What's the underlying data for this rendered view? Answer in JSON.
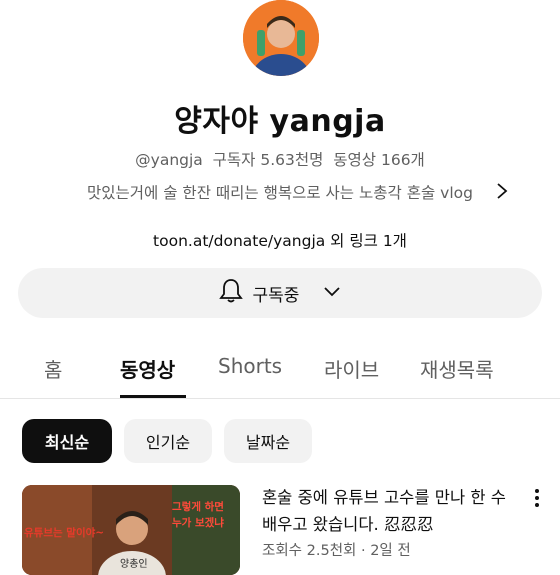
{
  "channel": {
    "name": "양자야 yangja",
    "meta": "@yangja  구독자 5.63천명  동영상 166개",
    "description": "맛있는거에 술 한잔 때리는 행복으로 사는 노총각 혼술 vlog",
    "link": "toon.at/donate/yangja 외 링크 1개"
  },
  "subscribe": {
    "label": "구독중"
  },
  "tabs": [
    "홈",
    "동영상",
    "Shorts",
    "라이브",
    "재생목록"
  ],
  "chips": [
    "최신순",
    "인기순",
    "날짜순"
  ],
  "video": {
    "title": "혼술 중에 유튜브 고수를 만나 한 수 배우고 왔습니다. 忍忍忍",
    "meta": "조회수 2.5천회 · 2일 전",
    "thumb_text_left": "유튜브는 말이야~",
    "thumb_text_right_1": "그렇게 하면",
    "thumb_text_right_2": "누가 보겠냐",
    "thumb_name": "양총인"
  },
  "colors": {
    "accent": "#0f0f0f",
    "secondary_text": "#606060",
    "chip_bg": "#f2f2f2",
    "avatar_bg": "#f07a2a"
  },
  "icons": {
    "bell": "bell-icon",
    "chevron_down": "chevron-down-icon",
    "chevron_right": "chevron-right-icon",
    "more": "more-vert-icon"
  }
}
